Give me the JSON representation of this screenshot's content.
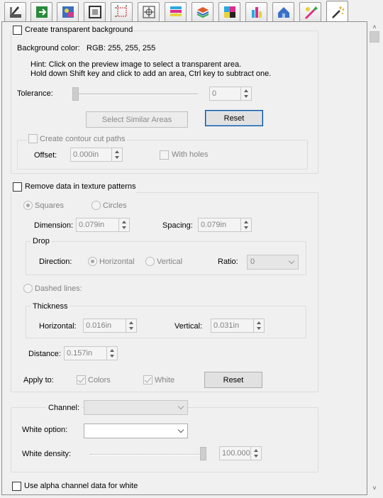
{
  "toolbar": {
    "tabs": [
      {
        "icon": "layout-icon"
      },
      {
        "icon": "transform-icon"
      },
      {
        "icon": "image-color-icon"
      },
      {
        "icon": "film-frame-icon"
      },
      {
        "icon": "crop-marks-icon"
      },
      {
        "icon": "target-icon"
      },
      {
        "icon": "color-bars-icon"
      },
      {
        "icon": "layers-icon"
      },
      {
        "icon": "cmyk-squares-icon"
      },
      {
        "icon": "ink-bars-icon"
      },
      {
        "icon": "house-shape-icon"
      },
      {
        "icon": "pen-gradient-icon"
      },
      {
        "icon": "magic-wand-icon"
      }
    ]
  },
  "transparent": {
    "checkbox_label": "Create transparent background",
    "bg_color_label": "Background color:",
    "bg_color_value": "RGB: 255, 255, 255",
    "hint_line1": "Hint: Click on the preview image to select a transparent area.",
    "hint_line2": "Hold down Shift key and click to add an area, Ctrl key to subtract one.",
    "tolerance_label": "Tolerance:",
    "tolerance_value": "0",
    "select_similar_label": "Select Similar Areas",
    "reset_label": "Reset",
    "contour_label": "Create contour cut paths",
    "offset_label": "Offset:",
    "offset_value": "0.000in",
    "with_holes_label": "With holes"
  },
  "texture": {
    "checkbox_label": "Remove data in texture patterns",
    "squares_label": "Squares",
    "circles_label": "Circles",
    "dimension_label": "Dimension:",
    "dimension_value": "0.079in",
    "spacing_label": "Spacing:",
    "spacing_value": "0.079in",
    "drop_title": "Drop",
    "direction_label": "Direction:",
    "horizontal_label": "Horizontal",
    "vertical_label": "Vertical",
    "ratio_label": "Ratio:",
    "ratio_value": "0",
    "dashed_label": "Dashed lines:",
    "thickness_title": "Thickness",
    "thick_h_label": "Horizontal:",
    "thick_h_value": "0.016in",
    "thick_v_label": "Vertical:",
    "thick_v_value": "0.031in",
    "distance_label": "Distance:",
    "distance_value": "0.157in",
    "apply_label": "Apply to:",
    "colors_label": "Colors",
    "white_label": "White",
    "reset_label": "Reset"
  },
  "white": {
    "channel_label": "Channel:",
    "channel_value": "",
    "white_option_label": "White option:",
    "white_option_value": "",
    "density_label": "White density:",
    "density_value": "100.000",
    "alpha_label": "Use alpha channel data for white"
  }
}
